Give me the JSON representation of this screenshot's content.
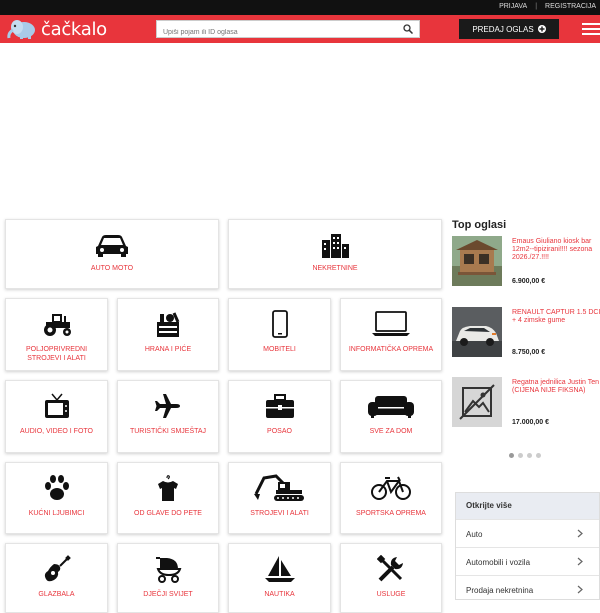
{
  "topbar": {
    "login": "PRIJAVA",
    "register": "REGISTRACIJA"
  },
  "header": {
    "logo_text": "čačkalo",
    "search_placeholder": "Upiši pojam ili ID oglasa",
    "post_button": "PREDAJ OGLAS"
  },
  "categories": {
    "auto_moto": "AUTO MOTO",
    "nekretnine": "NEKRETNINE",
    "poljoprivredni": "POLJOPRIVREDNI STROJEVI I ALATI",
    "hrana": "HRANA I PIĆE",
    "mobiteli": "MOBITELI",
    "informaticka": "INFORMATIČKA OPREMA",
    "audio": "AUDIO, VIDEO I FOTO",
    "turisticki": "TURISTIČKI SMJEŠTAJ",
    "posao": "POSAO",
    "sve_za_dom": "SVE ZA DOM",
    "kucni": "KUĆNI LJUBIMCI",
    "odjeca": "OD GLAVE DO PETE",
    "strojevi": "STROJEVI I ALATI",
    "sportska": "SPORTSKA OPREMA",
    "glazbala": "GLAZBALA",
    "djecji": "DJEČJI SVIJET",
    "nautika": "NAUTIKA",
    "usluge": "USLUGE"
  },
  "sidebar": {
    "title": "Top oglasi",
    "ads": [
      {
        "title": "Emaus Giuliano kiosk bar 12m2--tipizirani!!!! sezona 2026./27.!!!!",
        "price": "6.900,00 €"
      },
      {
        "title": "RENAULT CAPTUR 1.5 DCI + 4 zimske gume",
        "price": "8.750,00 €"
      },
      {
        "title": "Regatna jednilica Justin Ten (CIJENA NIJE FIKSNA)",
        "price": "17.000,00 €"
      }
    ],
    "discover_title": "Otkrijte više",
    "discover_items": [
      "Auto",
      "Automobili i vozila",
      "Prodaja nekretnina"
    ]
  },
  "colors": {
    "brand_red": "#e8353c",
    "dark": "#111111"
  }
}
